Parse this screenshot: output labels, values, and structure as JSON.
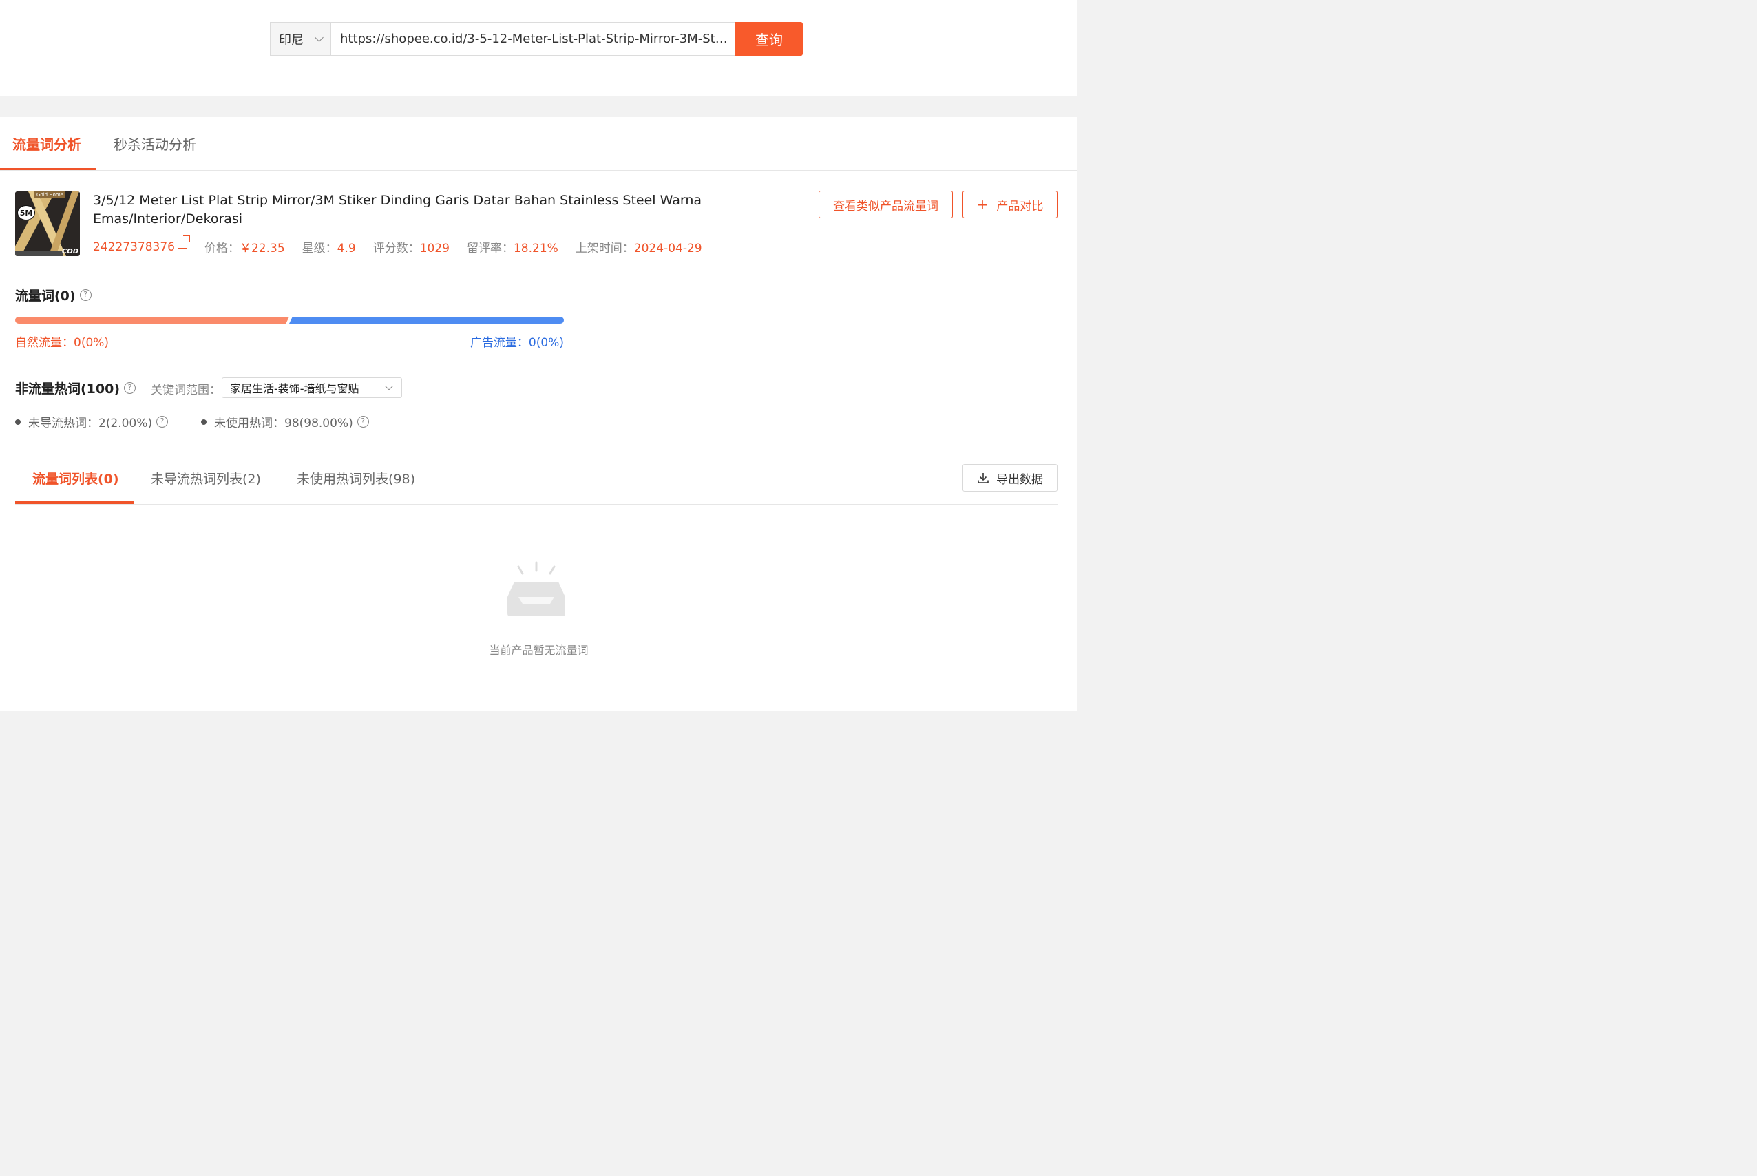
{
  "search": {
    "region": "印尼",
    "url_value": "https://shopee.co.id/3-5-12-Meter-List-Plat-Strip-Mirror-3M-St…",
    "button": "查询"
  },
  "top_tabs": [
    "流量词分析",
    "秒杀活动分析"
  ],
  "product": {
    "title": "3/5/12 Meter List Plat Strip Mirror/3M Stiker Dinding Garis Datar Bahan Stainless Steel Warna Emas/Interior/Dekorasi",
    "thumb_badge": "5M",
    "thumb_brand": "Gold Home",
    "thumb_cod": "COD",
    "id": "24227378376",
    "price_label": "价格：",
    "price": "￥22.35",
    "rating_label": "星级：",
    "rating": "4.9",
    "reviews_label": "评分数：",
    "reviews": "1029",
    "review_rate_label": "留评率：",
    "review_rate": "18.21%",
    "listed_label": "上架时间：",
    "listed": "2024-04-29"
  },
  "actions": {
    "similar": "查看类似产品流量词",
    "compare_plus": "+",
    "compare": "产品对比"
  },
  "traffic": {
    "heading": "流量词(0)",
    "natural_label": "自然流量：0(0%)",
    "ad_label": "广告流量：0(0%)",
    "natural_share": 0.5,
    "ad_share": 0.5
  },
  "hot": {
    "heading": "非流量热词(100)",
    "range_label": "关键词范围：",
    "range_value": "家居生活-装饰-墙纸与窗贴",
    "stat1": "未导流热词：2(2.00%)",
    "stat2": "未使用热词：98(98.00%)"
  },
  "list_tabs": {
    "tab1": "流量词列表(0)",
    "tab2": "未导流热词列表(2)",
    "tab3": "未使用热词列表(98)",
    "export": "导出数据"
  },
  "empty": {
    "text": "当前产品暂无流量词"
  },
  "colors": {
    "accent": "#f0542a",
    "search_button": "#f85a2b",
    "natural_bar": "#fa8a6a",
    "ad_bar": "#4e8cf2"
  },
  "help_icon_glyph": "?"
}
